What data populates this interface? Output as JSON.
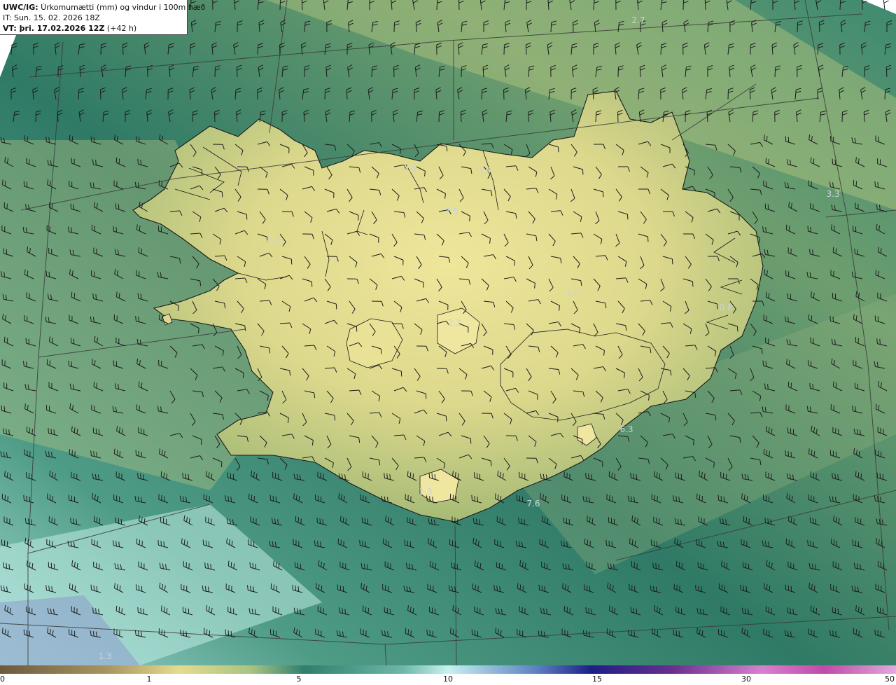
{
  "header": {
    "line1_bold": "UWC/IG:",
    "line1_rest": " Úrkomumætti (mm) og vindur i 100m hæð",
    "line2": "IT: Sun. 15. 02. 2026 18Z",
    "line3_bold": "VT: þri. 17.02.2026 12Z",
    "line3_rest": " (+42 h)"
  },
  "map": {
    "value_labels": [
      "2.7",
      "3.8",
      "3.9",
      "7.5",
      "4.0",
      "3.3",
      "1.0",
      "0.8",
      "2.2",
      "6.3",
      "1.3",
      "7.6",
      "1.3"
    ],
    "colors": {
      "ocean_deep": "#2f7a66",
      "ocean_mid": "#4a8f74",
      "land_low": "#b5c47a",
      "land_high": "#ece495",
      "coast": "#1a1a1a",
      "barb": "#1c1c1c",
      "grid": "#3a3a3a"
    }
  },
  "colorbar": {
    "ticks": [
      "0",
      "1",
      "5",
      "10",
      "15",
      "30",
      "50"
    ],
    "colors": [
      "#6b5a3e",
      "#b7a66e",
      "#e8df93",
      "#7fae78",
      "#2f7f6c",
      "#bff0ef",
      "#2a2a9a",
      "#5a1f8a",
      "#b64db0",
      "#d48ad0"
    ]
  }
}
